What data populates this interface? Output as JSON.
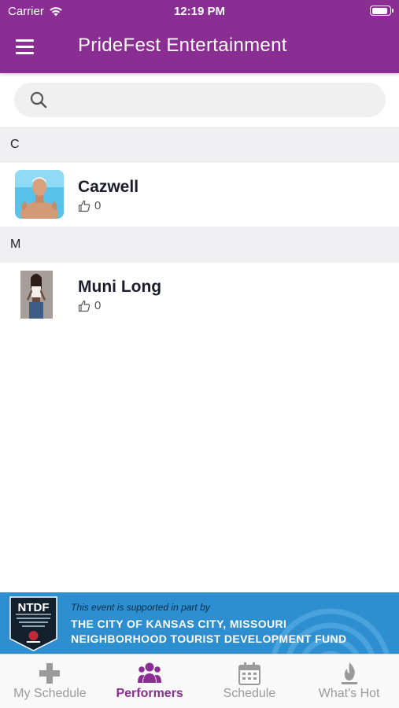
{
  "status_bar": {
    "carrier": "Carrier",
    "time": "12:19 PM",
    "battery_level": 0.95
  },
  "header": {
    "title": "PrideFest Entertainment",
    "menu_icon": "hamburger-menu-icon"
  },
  "search": {
    "placeholder": "",
    "value": "",
    "icon": "search-icon"
  },
  "sections": [
    {
      "letter": "C",
      "performers": [
        {
          "name": "Cazwell",
          "likes": "0"
        }
      ]
    },
    {
      "letter": "M",
      "performers": [
        {
          "name": "Muni Long",
          "likes": "0"
        }
      ]
    }
  ],
  "sponsor": {
    "logo_text": "NTDF",
    "intro": "This event is supported in part by",
    "line1": "THE CITY OF KANSAS CITY, MISSOURI",
    "line2": "NEIGHBORHOOD TOURIST DEVELOPMENT FUND"
  },
  "tabs": [
    {
      "label": "My Schedule",
      "icon": "plus-icon",
      "active": false
    },
    {
      "label": "Performers",
      "icon": "people-icon",
      "active": true
    },
    {
      "label": "Schedule",
      "icon": "calendar-icon",
      "active": false
    },
    {
      "label": "What's Hot",
      "icon": "flame-icon",
      "active": false
    }
  ],
  "colors": {
    "brand": "#8a2e93",
    "banner": "#2d8fd0",
    "tab_inactive": "#9a9a9a"
  }
}
